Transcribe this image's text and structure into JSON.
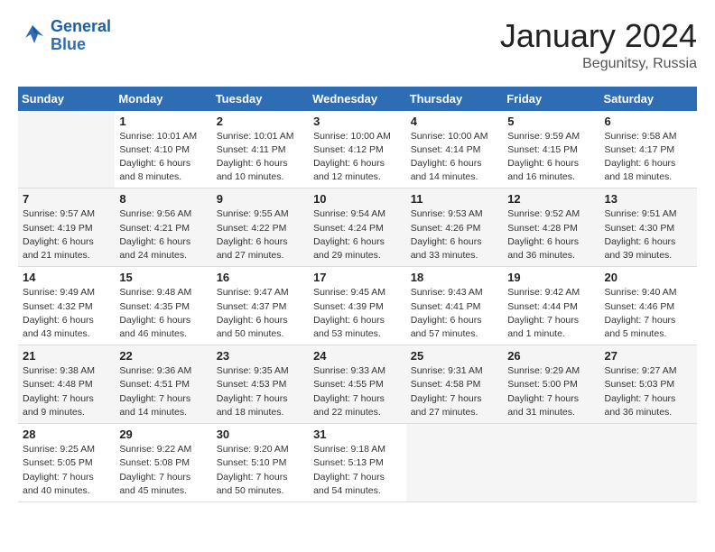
{
  "header": {
    "logo_line1": "General",
    "logo_line2": "Blue",
    "month": "January 2024",
    "location": "Begunitsy, Russia"
  },
  "weekdays": [
    "Sunday",
    "Monday",
    "Tuesday",
    "Wednesday",
    "Thursday",
    "Friday",
    "Saturday"
  ],
  "weeks": [
    [
      {
        "day": "",
        "info": ""
      },
      {
        "day": "1",
        "info": "Sunrise: 10:01 AM\nSunset: 4:10 PM\nDaylight: 6 hours\nand 8 minutes."
      },
      {
        "day": "2",
        "info": "Sunrise: 10:01 AM\nSunset: 4:11 PM\nDaylight: 6 hours\nand 10 minutes."
      },
      {
        "day": "3",
        "info": "Sunrise: 10:00 AM\nSunset: 4:12 PM\nDaylight: 6 hours\nand 12 minutes."
      },
      {
        "day": "4",
        "info": "Sunrise: 10:00 AM\nSunset: 4:14 PM\nDaylight: 6 hours\nand 14 minutes."
      },
      {
        "day": "5",
        "info": "Sunrise: 9:59 AM\nSunset: 4:15 PM\nDaylight: 6 hours\nand 16 minutes."
      },
      {
        "day": "6",
        "info": "Sunrise: 9:58 AM\nSunset: 4:17 PM\nDaylight: 6 hours\nand 18 minutes."
      }
    ],
    [
      {
        "day": "7",
        "info": "Sunrise: 9:57 AM\nSunset: 4:19 PM\nDaylight: 6 hours\nand 21 minutes."
      },
      {
        "day": "8",
        "info": "Sunrise: 9:56 AM\nSunset: 4:21 PM\nDaylight: 6 hours\nand 24 minutes."
      },
      {
        "day": "9",
        "info": "Sunrise: 9:55 AM\nSunset: 4:22 PM\nDaylight: 6 hours\nand 27 minutes."
      },
      {
        "day": "10",
        "info": "Sunrise: 9:54 AM\nSunset: 4:24 PM\nDaylight: 6 hours\nand 29 minutes."
      },
      {
        "day": "11",
        "info": "Sunrise: 9:53 AM\nSunset: 4:26 PM\nDaylight: 6 hours\nand 33 minutes."
      },
      {
        "day": "12",
        "info": "Sunrise: 9:52 AM\nSunset: 4:28 PM\nDaylight: 6 hours\nand 36 minutes."
      },
      {
        "day": "13",
        "info": "Sunrise: 9:51 AM\nSunset: 4:30 PM\nDaylight: 6 hours\nand 39 minutes."
      }
    ],
    [
      {
        "day": "14",
        "info": "Sunrise: 9:49 AM\nSunset: 4:32 PM\nDaylight: 6 hours\nand 43 minutes."
      },
      {
        "day": "15",
        "info": "Sunrise: 9:48 AM\nSunset: 4:35 PM\nDaylight: 6 hours\nand 46 minutes."
      },
      {
        "day": "16",
        "info": "Sunrise: 9:47 AM\nSunset: 4:37 PM\nDaylight: 6 hours\nand 50 minutes."
      },
      {
        "day": "17",
        "info": "Sunrise: 9:45 AM\nSunset: 4:39 PM\nDaylight: 6 hours\nand 53 minutes."
      },
      {
        "day": "18",
        "info": "Sunrise: 9:43 AM\nSunset: 4:41 PM\nDaylight: 6 hours\nand 57 minutes."
      },
      {
        "day": "19",
        "info": "Sunrise: 9:42 AM\nSunset: 4:44 PM\nDaylight: 7 hours\nand 1 minute."
      },
      {
        "day": "20",
        "info": "Sunrise: 9:40 AM\nSunset: 4:46 PM\nDaylight: 7 hours\nand 5 minutes."
      }
    ],
    [
      {
        "day": "21",
        "info": "Sunrise: 9:38 AM\nSunset: 4:48 PM\nDaylight: 7 hours\nand 9 minutes."
      },
      {
        "day": "22",
        "info": "Sunrise: 9:36 AM\nSunset: 4:51 PM\nDaylight: 7 hours\nand 14 minutes."
      },
      {
        "day": "23",
        "info": "Sunrise: 9:35 AM\nSunset: 4:53 PM\nDaylight: 7 hours\nand 18 minutes."
      },
      {
        "day": "24",
        "info": "Sunrise: 9:33 AM\nSunset: 4:55 PM\nDaylight: 7 hours\nand 22 minutes."
      },
      {
        "day": "25",
        "info": "Sunrise: 9:31 AM\nSunset: 4:58 PM\nDaylight: 7 hours\nand 27 minutes."
      },
      {
        "day": "26",
        "info": "Sunrise: 9:29 AM\nSunset: 5:00 PM\nDaylight: 7 hours\nand 31 minutes."
      },
      {
        "day": "27",
        "info": "Sunrise: 9:27 AM\nSunset: 5:03 PM\nDaylight: 7 hours\nand 36 minutes."
      }
    ],
    [
      {
        "day": "28",
        "info": "Sunrise: 9:25 AM\nSunset: 5:05 PM\nDaylight: 7 hours\nand 40 minutes."
      },
      {
        "day": "29",
        "info": "Sunrise: 9:22 AM\nSunset: 5:08 PM\nDaylight: 7 hours\nand 45 minutes."
      },
      {
        "day": "30",
        "info": "Sunrise: 9:20 AM\nSunset: 5:10 PM\nDaylight: 7 hours\nand 50 minutes."
      },
      {
        "day": "31",
        "info": "Sunrise: 9:18 AM\nSunset: 5:13 PM\nDaylight: 7 hours\nand 54 minutes."
      },
      {
        "day": "",
        "info": ""
      },
      {
        "day": "",
        "info": ""
      },
      {
        "day": "",
        "info": ""
      }
    ]
  ]
}
